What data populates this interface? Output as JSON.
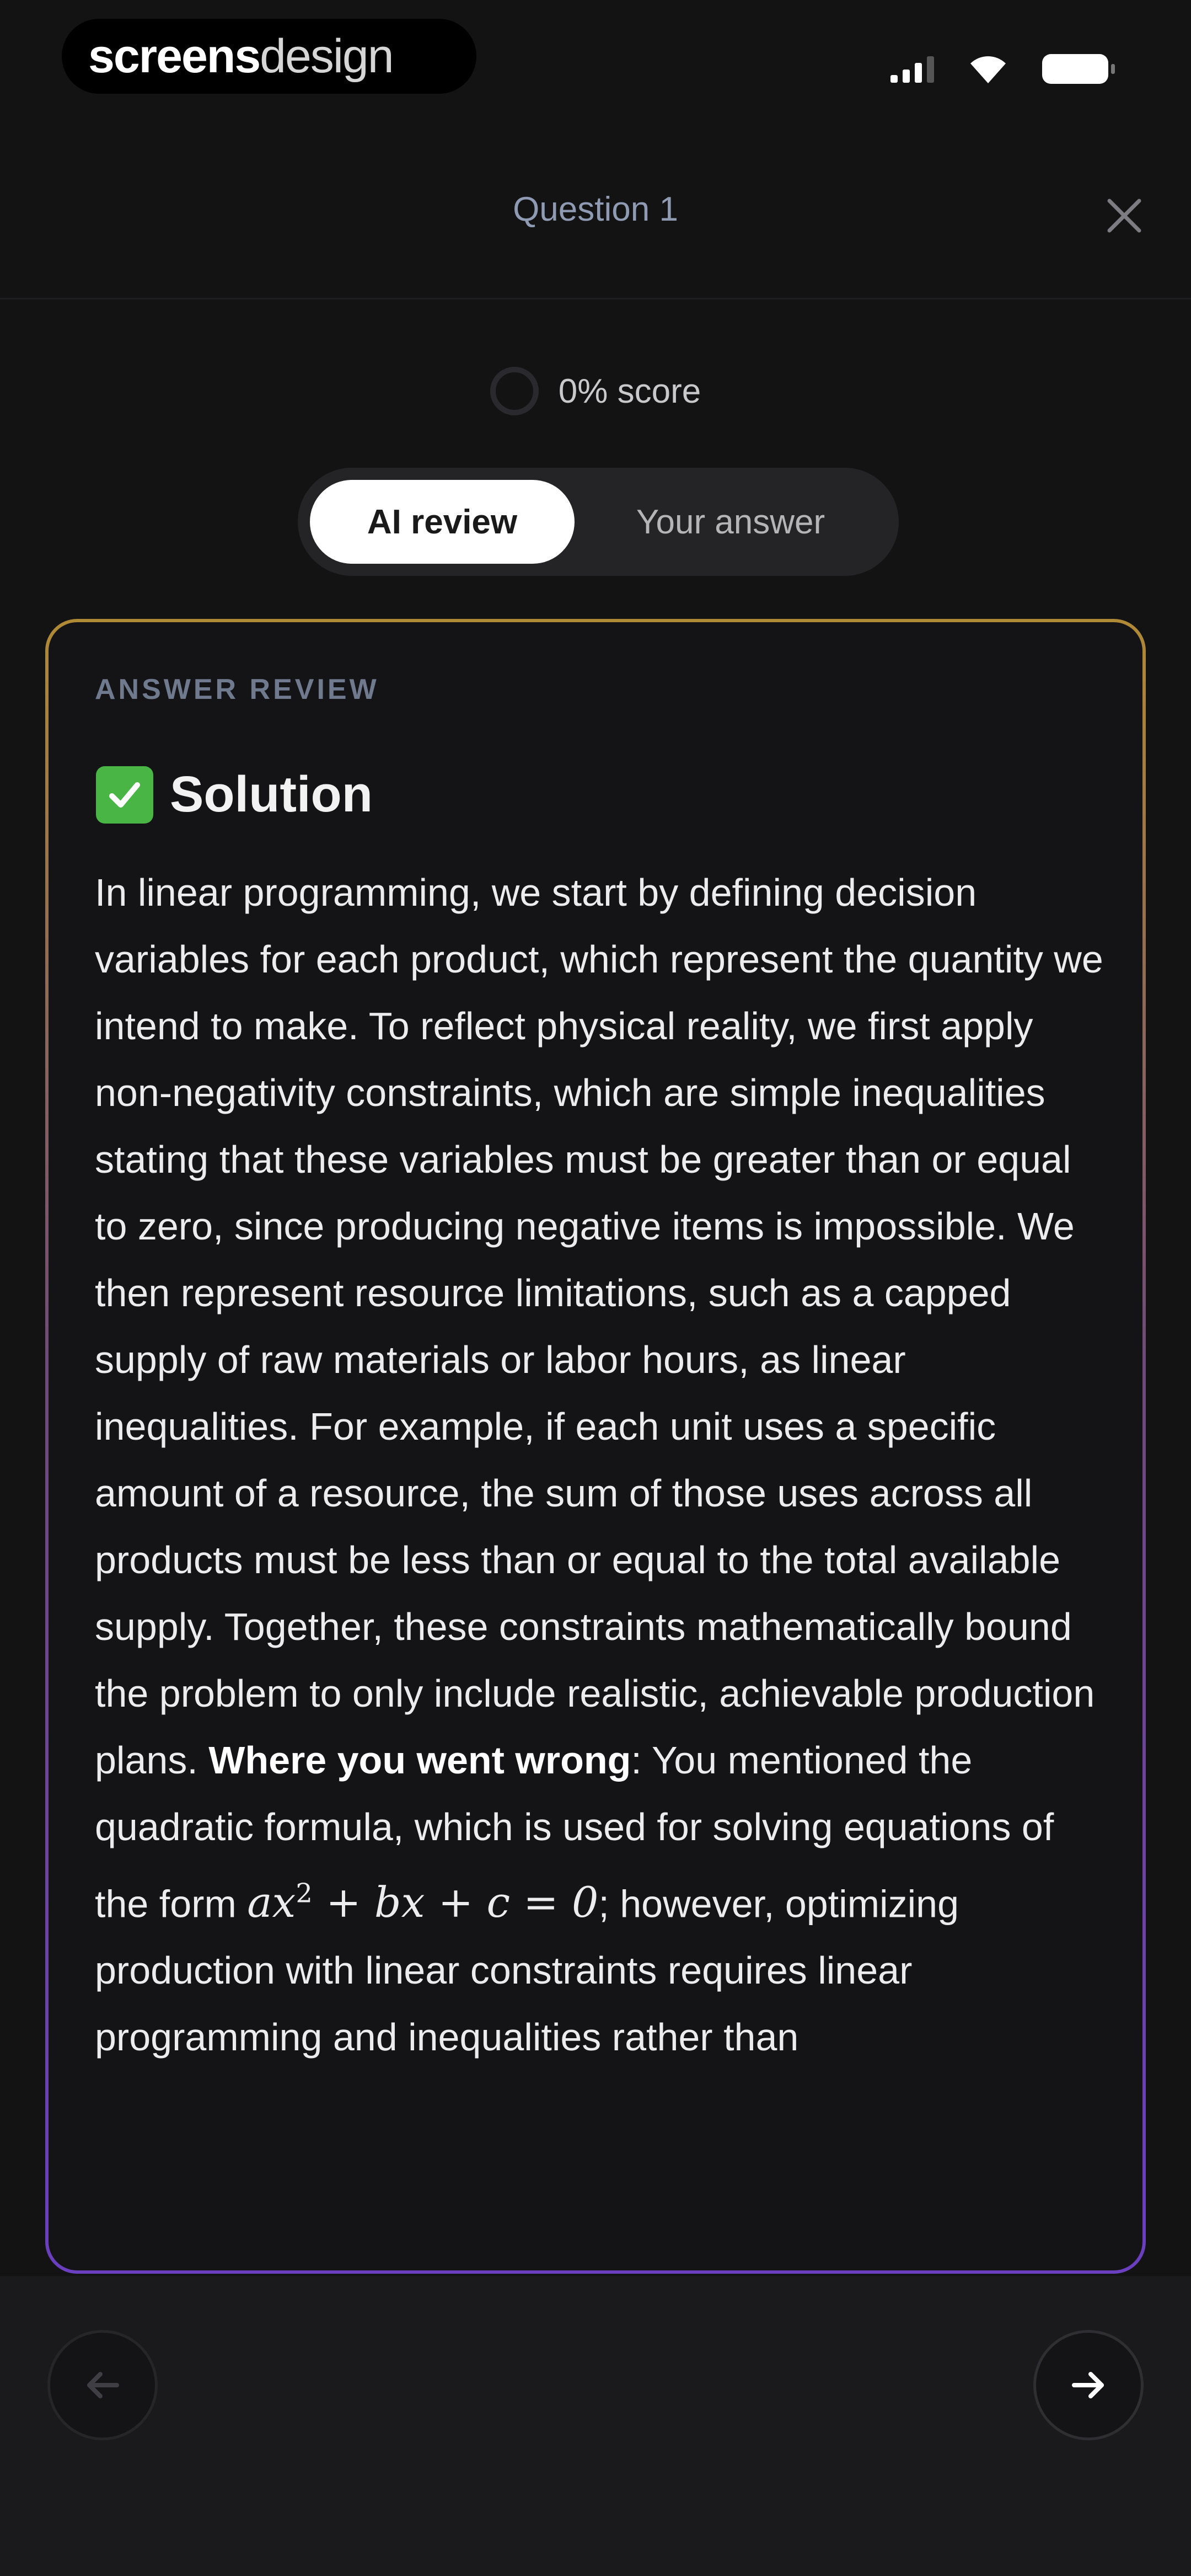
{
  "status_bar": {
    "brand_strong": "screens",
    "brand_light": "design"
  },
  "header": {
    "title": "Question 1"
  },
  "score": {
    "label": "0% score",
    "value_percent": 0
  },
  "tabs": [
    {
      "label": "AI review",
      "active": true
    },
    {
      "label": "Your answer",
      "active": false
    }
  ],
  "review": {
    "section_label": "ANSWER REVIEW",
    "heading": "Solution",
    "heading_icon": "check-box-icon",
    "paragraph_part1": "In linear programming, we start by defining decision variables for each product, which represent the quantity we intend to make. To reflect physical reality, we first apply non-negativity constraints, which are simple inequalities stating that these variables must be greater than or equal to zero, since producing negative items is impossible. We then represent resource limitations, such as a capped supply of raw materials or labor hours, as linear inequalities. For example, if each unit uses a specific amount of a resource, the sum of those uses across all products must be less than or equal to the total available supply. Together, these constraints mathematically bound the problem to only include realistic, achievable production plans. ",
    "emphasis": "Where you went wrong",
    "paragraph_part2": ": You mentioned the quadratic formula, which is used for solving equations of the form ",
    "math_base": "ax",
    "math_exp": "2",
    "math_rest": " + bx + c = 0",
    "paragraph_part3": "; however, optimizing production with linear constraints requires linear programming and inequalities rather than"
  },
  "colors": {
    "background": "#131314",
    "accent_gold": "#b08a35",
    "accent_purple": "#6a3fc0",
    "check_green": "#49b545"
  },
  "navigation": {
    "prev_icon": "arrow-left-icon",
    "next_icon": "arrow-right-icon"
  }
}
